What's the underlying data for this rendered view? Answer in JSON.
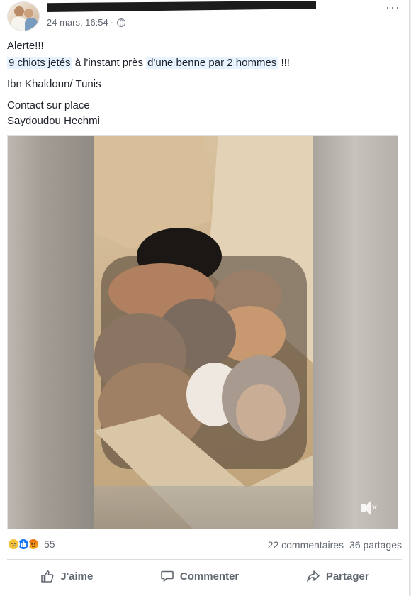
{
  "post": {
    "timestamp": "24 mars, 16:54",
    "separator": "·",
    "more_label": "···",
    "text": {
      "line1": "Alerte!!!",
      "line2_part1": "9 chiots jetés",
      "line2_part2": " à l'instant près ",
      "line2_part3": "d'une benne par 2 hommes",
      "line2_part4": " !!!",
      "line3": "Ibn Khaldoun/ Tunis",
      "line4": "Contact sur place",
      "line5": "Saydoudou Hechmi"
    }
  },
  "footer": {
    "reaction_count": "55",
    "comments": "22 commentaires",
    "shares": "36 partages"
  },
  "actions": {
    "like": "J'aime",
    "comment": "Commenter",
    "share": "Partager"
  },
  "icons": {
    "privacy": "globe-icon",
    "mute": "muted-speaker-icon",
    "like": "thumbs-up-icon",
    "comment": "speech-bubble-icon",
    "share": "share-arrow-icon"
  },
  "colors": {
    "highlight": "#e7f3ff",
    "like_blue": "#1877f2",
    "text_secondary": "#616770"
  }
}
